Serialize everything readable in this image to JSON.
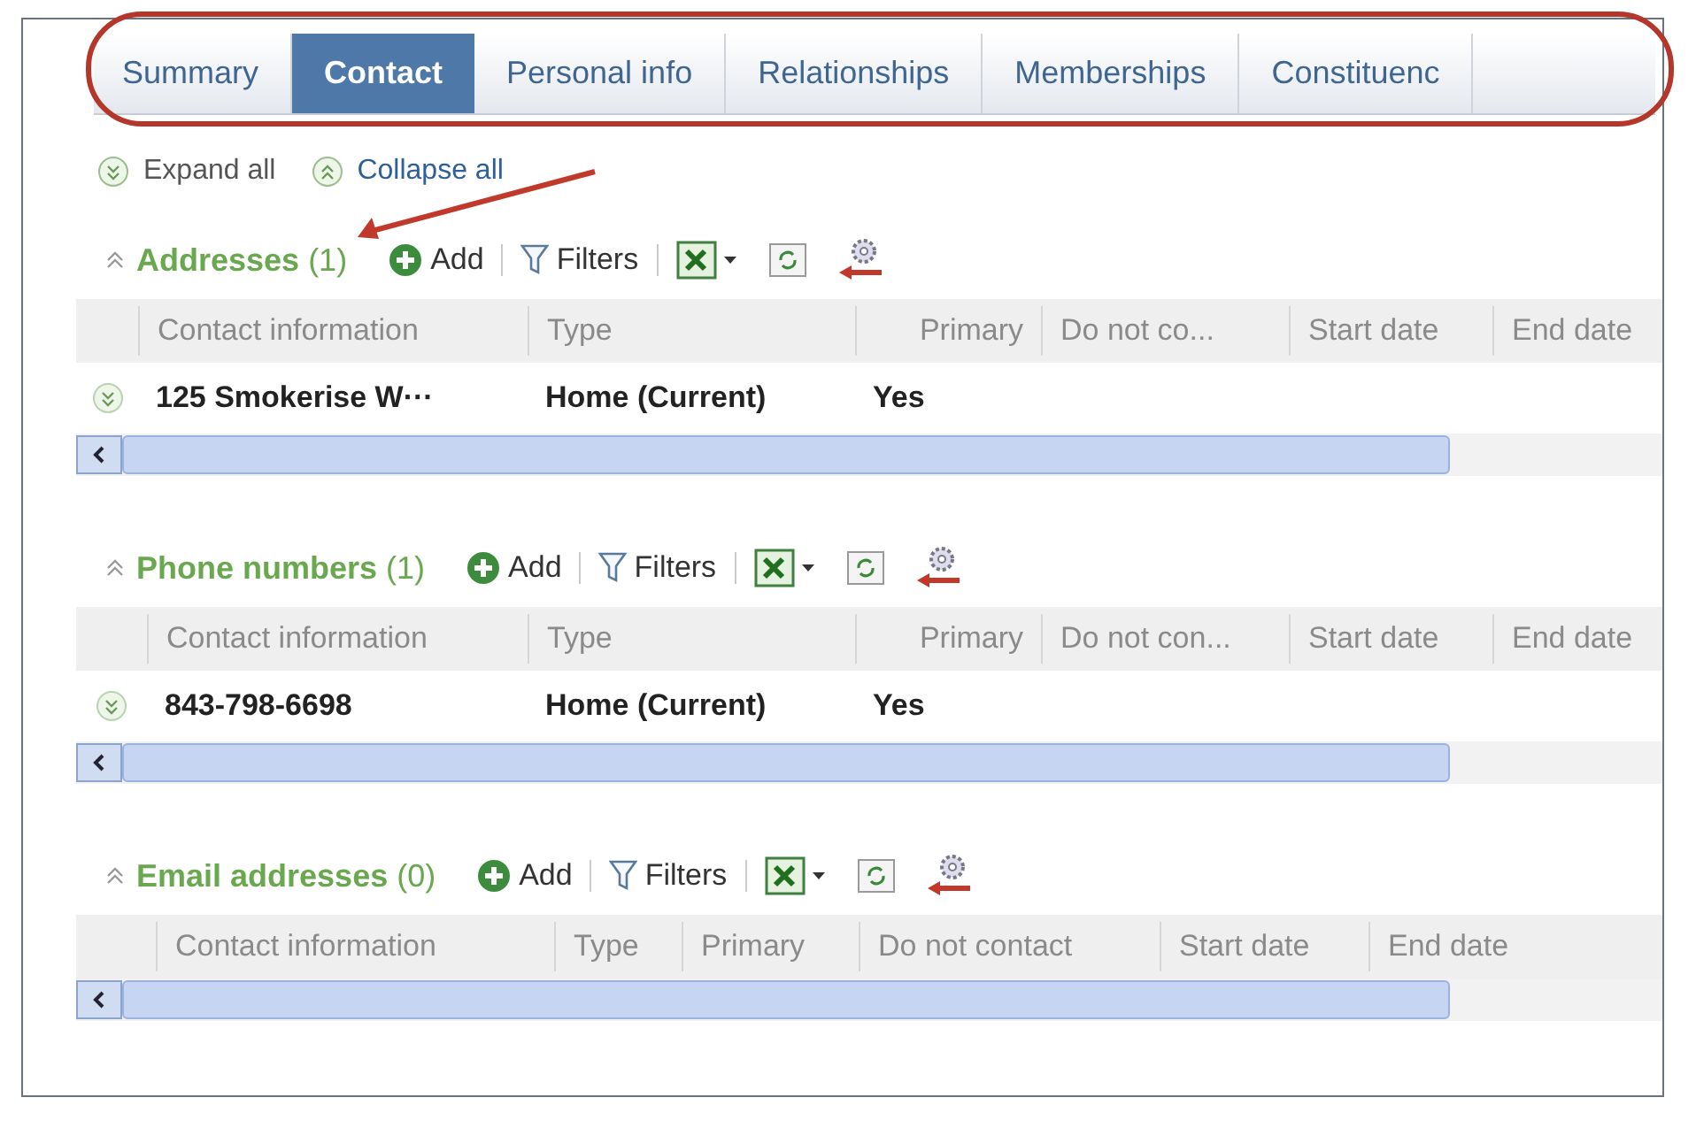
{
  "tabs": [
    {
      "label": "Summary",
      "selected": false
    },
    {
      "label": "Contact",
      "selected": true
    },
    {
      "label": "Personal info",
      "selected": false
    },
    {
      "label": "Relationships",
      "selected": false
    },
    {
      "label": "Memberships",
      "selected": false
    },
    {
      "label": "Constituenc",
      "selected": false
    }
  ],
  "expand_all": "Expand all",
  "collapse_all": "Collapse all",
  "sections": [
    {
      "title": "**Addresses** (1)",
      "add": "Add",
      "filters": "Filters",
      "columns": [
        "Contact information",
        "Type",
        "Primary",
        "Do not co...",
        "Start date",
        "End date"
      ],
      "rows": [
        [
          "125 Smokerise W···",
          "Home (Current)",
          "Yes",
          "",
          "",
          ""
        ]
      ]
    },
    {
      "title": "**Phone numbers** (1)",
      "add": "Add",
      "filters": "Filters",
      "columns": [
        "Contact information",
        "Type",
        "Primary",
        "Do not con...",
        "Start date",
        "End date"
      ],
      "rows": [
        [
          "843-798-6698",
          "Home (Current)",
          "Yes",
          "",
          "",
          ""
        ]
      ]
    },
    {
      "title": "**Email addresses** (0)",
      "add": "Add",
      "filters": "Filters",
      "columns": [
        "Contact information",
        "Type",
        "Primary",
        "Do not contact",
        "Start date",
        "End date"
      ]
    }
  ]
}
